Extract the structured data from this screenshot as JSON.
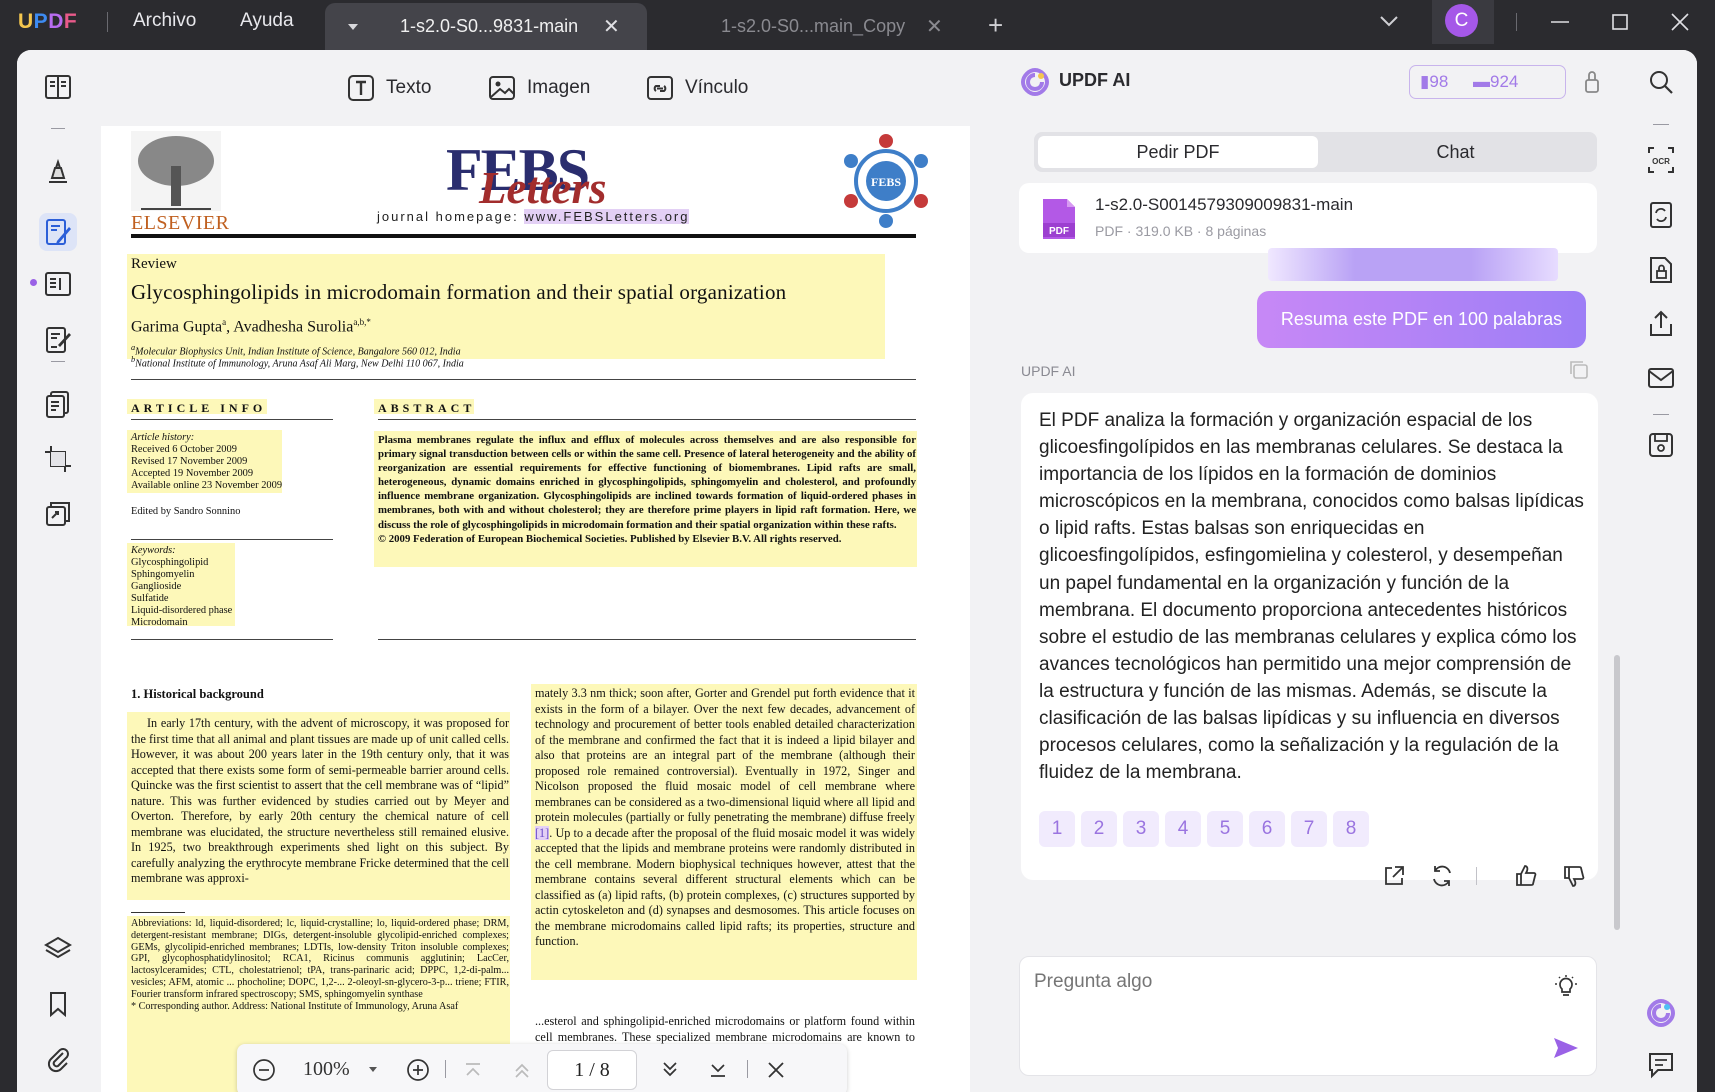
{
  "titlebar": {
    "logo": {
      "u": "U",
      "p": "P",
      "d": "D",
      "f": "F"
    },
    "menu": [
      "Archivo",
      "Ayuda"
    ],
    "tabs": [
      {
        "label": "1-s2.0-S0...9831-main"
      },
      {
        "label": "1-s2.0-S0...main_Copy"
      }
    ],
    "close_glyph": "✕",
    "add_tab_glyph": "+",
    "avatar_letter": "C"
  },
  "toolbar": {
    "text": "Texto",
    "image": "Imagen",
    "link": "Vínculo"
  },
  "document": {
    "publisher": "ELSEVIER",
    "journal_big": "FEBS",
    "journal_script": "Letters",
    "homepage_label": "journal homepage:",
    "homepage_url": "www.FEBSLetters.org",
    "seal_text": "FEBS",
    "section_type": "Review",
    "title": "Glycosphingolipids in microdomain formation and their spatial organization",
    "author1": "Garima Gupta",
    "author1_sup": "a",
    "author_sep": ", ",
    "author2": "Avadhesha Surolia",
    "author2_sup": "a,b,",
    "author2_star": "*",
    "aff_a_sup": "a",
    "aff_a": "Molecular Biophysics Unit, Indian Institute of Science, Bangalore 560 012, India",
    "aff_b_sup": "b",
    "aff_b": "National Institute of Immunology, Aruna Asaf Ali Marg, New Delhi 110 067, India",
    "article_info_head": "ARTICLE INFO",
    "abstract_head": "ABSTRACT",
    "history_head": "Article history:",
    "history": [
      "Received 6 October 2009",
      "Revised 17 November 2009",
      "Accepted 19 November 2009",
      "Available online 23 November 2009"
    ],
    "edited_by": "Edited by Sandro Sonnino",
    "keywords_head": "Keywords:",
    "keywords": [
      "Glycosphingolipid",
      "Sphingomyelin",
      "Ganglioside",
      "Sulfatide",
      "Liquid-disordered phase",
      "Microdomain"
    ],
    "abstract_text": "Plasma membranes regulate the influx and efflux of molecules across themselves and are also responsible for primary signal transduction between cells or within the same cell. Presence of lateral heterogeneity and the ability of reorganization are essential requirements for effective functioning of biomembranes. Lipid rafts are small, heterogeneous, dynamic domains enriched in glycosphingolipids, sphingomyelin and cholesterol, and profoundly influence membrane organization. Glycosphingolipids are inclined towards formation of liquid-ordered phases in membranes, both with and without cholesterol; they are therefore prime players in lipid raft formation. Here, we discuss the role of glycosphingolipids in microdomain formation and their spatial organization within these rafts.",
    "copyright": "© 2009 Federation of European Biochemical Societies. Published by Elsevier B.V. All rights reserved.",
    "section1_head": "1. Historical background",
    "col1": "In early 17th century, with the advent of microscopy, it was proposed for the first time that all animal and plant tissues are made up of unit called cells. However, it was about 200 years later in the 19th century only, that it was accepted that there exists some form of semi-permeable barrier around cells. Quincke was the first scientist to assert that the cell membrane was of “lipid” nature. This was further evidenced by studies carried out by Meyer and Overton. Therefore, by early 20th century the chemical nature of cell membrane was elucidated, the structure nevertheless still remained elusive. In 1925, two breakthrough experiments shed light on this subject. By carefully analyzing the erythrocyte membrane Fricke determined that the cell membrane was approxi-",
    "col2_a": "mately 3.3 nm thick; soon after, Gorter and Grendel put forth evidence that it exists in the form of a bilayer. Over the next few decades, advancement of technology and procurement of better tools enabled detailed characterization of the membrane and confirmed the fact that it is indeed a lipid bilayer and also that proteins are an integral part of the membrane (although their proposed role remained controversial). Eventually in 1972, Singer and Nicolson proposed the fluid mosaic model of cell membrane where membranes can be considered as a two-dimensional liquid where all lipid and protein molecules (partially or fully penetrating the membrane) diffuse freely ",
    "col2_ref": "[1]",
    "col2_b": ". Up to a decade after the proposal of the fluid mosaic model it was widely accepted that the lipids and membrane proteins were randomly distributed in the cell membrane. Modern biophysical techniques however, attest that the membrane contains several different structural elements which can be classified as (a) lipid rafts, (b) protein complexes, (c) structures supported by actin cytoskeleton and (d) synapses and desmosomes. This article focuses on the membrane microdomains called lipid rafts; its properties, structure and function.",
    "footnote": "Abbreviations: ld, liquid-disordered; lc, liquid-crystalline; lo, liquid-ordered phase; DRM, detergent-resistant membrane; DIGs, detergent-insoluble glycolipid-enriched complexes; GEMs, glycolipid-enriched membranes; LDTIs, low-density Triton insoluble complexes; GPI, glycophosphatidylinositol; RCA1, Ricinus communis agglutinin; LacCer, lactosylceramides; CTL, cholestatrienol; tPA, trans-parinaric acid; DPPC, 1,2-di-palm... vesicles; AFM, atomic ... phocholine; DOPC, 1,2-... 2-oleoyl-sn-glycero-3-p... triene; FTIR, Fourier transform infrared spectroscopy; SMS, sphingomyelin synthase",
    "corresponding": "* Corresponding author. Address: National Institute of Immunology, Aruna Asaf",
    "col3": "...esterol and sphingolipid-enriched microdomains or platform found within cell membranes. These specialized membrane microdomains are known to compartmentalize cellular processes by serving"
  },
  "navbar": {
    "zoom": "100%",
    "page": "1",
    "page_sep": "/",
    "total": "8"
  },
  "ai": {
    "title": "UPDF AI",
    "credit1": "98",
    "credit2": "924",
    "tab_pdf": "Pedir PDF",
    "tab_chat": "Chat",
    "file_name": "1-s2.0-S0014579309009831-main",
    "file_meta": "PDF · 319.0 KB · 8 páginas",
    "pdf_badge": "PDF",
    "user_msg": "Resuma este PDF en 100 palabras",
    "label": "UPDF AI",
    "response": "El PDF analiza la formación y organización espacial de los glicoesfingolípidos en las membranas celulares. Se destaca la importancia de los lípidos en la formación de dominios microscópicos en la membrana, conocidos como balsas lipídicas o lipid rafts. Estas balsas son enriquecidas en glicoesfingolípidos, esfingomielina y colesterol, y desempeñan un papel fundamental en la organización y función de la membrana. El documento proporciona antecedentes históricos sobre el estudio de las membranas celulares y explica cómo los avances tecnológicos han permitido una mejor comprensión de la estructura y función de las mismas. Además, se discute la clasificación de las balsas lipídicas y su influencia en diversos procesos celulares, como la señalización y la regulación de la fluidez de la membrana.",
    "refs": [
      "1",
      "2",
      "3",
      "4",
      "5",
      "6",
      "7",
      "8"
    ],
    "input_placeholder": "Pregunta algo"
  },
  "rightrail": {
    "ocr_label": "OCR"
  },
  "colors": {
    "accent": "#9a62e6",
    "highlight": "#fdf8b9",
    "bubble_start": "#c788f6",
    "bubble_end": "#9d7ef6",
    "ref_bg": "#f1ebfd"
  }
}
